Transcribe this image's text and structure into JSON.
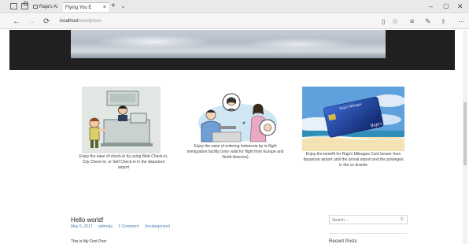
{
  "browser": {
    "tabs": [
      {
        "label": "Raja's Ai"
      },
      {
        "label": "Flying You E"
      }
    ],
    "tab_close": "×",
    "new_tab": "+",
    "tab_menu": "⌄",
    "window_controls": {
      "minimize": "–",
      "maximize": "▢",
      "close": "✕"
    },
    "nav": {
      "back": "←",
      "forward": "→",
      "refresh": "⟳"
    },
    "url": {
      "host": "localhost",
      "path": "/wordpress"
    },
    "tools": {
      "reading": "▯",
      "favorite": "☆",
      "hub": "≡",
      "notes": "✎",
      "share": "⇪",
      "more": "⋯"
    }
  },
  "features": [
    {
      "caption": "Enjoy the ease of check-in by using Web Check-in, City Check-in, or Self Check-in in the departure airport",
      "illustration": "check-in-kiosk-illustration"
    },
    {
      "caption": "Enjoy the ease of entering Indonesia by in-flight immigration facility (only valid for flight from Europe and North America)",
      "illustration": "in-flight-immigration-illustration"
    },
    {
      "caption": "Enjoy the benefit for Raja's Mileages Card bearer from departure airport until the arrival airport and the privileges in the co-brands",
      "card_text": "Raja's Mileages",
      "card_brand": "Raja's"
    }
  ],
  "post": {
    "title": "Hello world!",
    "date": "May 5, 2017",
    "author": "admraja",
    "comments": "1 Comment",
    "category": "Uncategorized",
    "excerpt": "This is My First Post"
  },
  "sidebar": {
    "search_placeholder": "Search ...",
    "recent_posts_heading": "Recent Posts"
  }
}
